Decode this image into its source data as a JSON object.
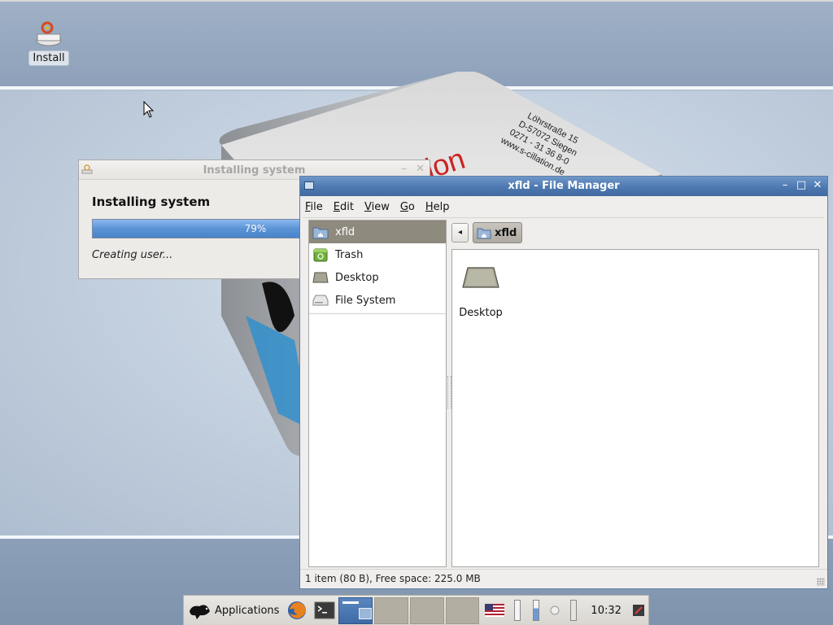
{
  "desktop": {
    "wallpaper": {
      "brand": "S-cillation",
      "address": [
        "Löhrstraße 15",
        "D-57072 Siegen",
        "0271 - 31 36 8-0",
        "www.s-cillation.de"
      ]
    },
    "icons": [
      {
        "label": "Install",
        "icon": "installer-disc-icon"
      }
    ]
  },
  "installer": {
    "title": "Installing system",
    "heading": "Installing system",
    "progress_label": "79%",
    "progress": 0.79,
    "status": "Creating user...",
    "controls": {
      "minimize": "–",
      "close": "✕"
    }
  },
  "file_manager": {
    "title": "xfld - File Manager",
    "controls": {
      "minimize": "–",
      "maximize": "□",
      "close": "✕"
    },
    "menus": [
      {
        "label": "File",
        "mnemonic": "F",
        "rest": "ile"
      },
      {
        "label": "Edit",
        "mnemonic": "E",
        "rest": "dit"
      },
      {
        "label": "View",
        "mnemonic": "V",
        "rest": "iew"
      },
      {
        "label": "Go",
        "mnemonic": "G",
        "rest": "o"
      },
      {
        "label": "Help",
        "mnemonic": "H",
        "rest": "elp"
      }
    ],
    "places": [
      {
        "label": "xfld",
        "icon": "home-folder-icon",
        "selected": true
      },
      {
        "label": "Trash",
        "icon": "trash-icon",
        "selected": false
      },
      {
        "label": "Desktop",
        "icon": "desktop-icon",
        "selected": false
      },
      {
        "label": "File System",
        "icon": "drive-icon",
        "selected": false
      }
    ],
    "path": {
      "back_label": "◂",
      "current": "xfld"
    },
    "items": [
      {
        "label": "Desktop",
        "icon": "desktop-folder-icon"
      }
    ],
    "statusbar": "1 item (80 B), Free space: 225.0 MB"
  },
  "panel": {
    "applications_label": "Applications",
    "clock": "10:32",
    "keyboard_layout": "US",
    "colors": {
      "active_task": "#3e6aa6",
      "task": "#b3aea2"
    }
  }
}
